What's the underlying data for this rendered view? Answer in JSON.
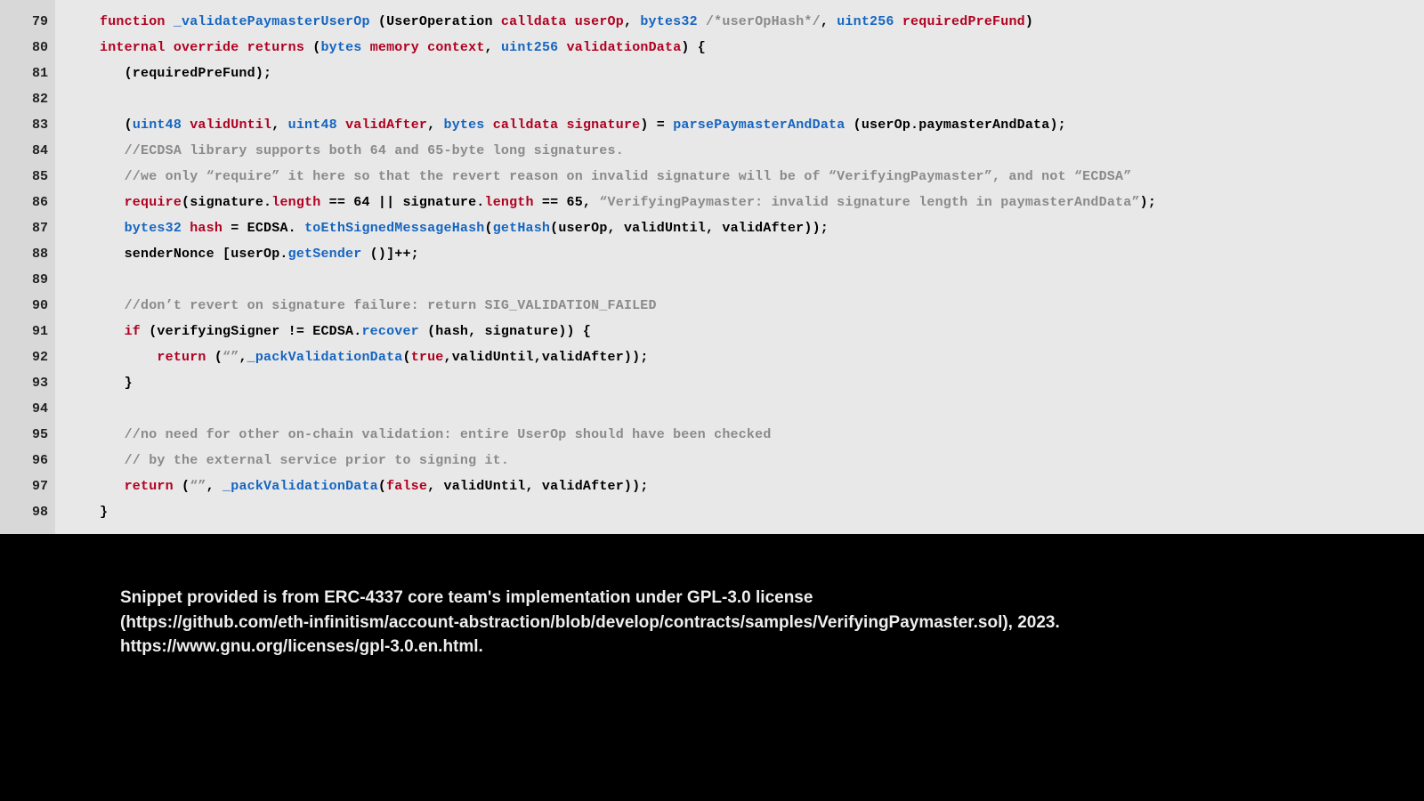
{
  "first_line_no": 79,
  "lines": [
    [
      {
        "cls": "kw",
        "t": "function"
      },
      {
        "t": " "
      },
      {
        "cls": "fn",
        "t": "_validatePaymasterUserOp"
      },
      {
        "t": " ("
      },
      {
        "t": "UserOperation "
      },
      {
        "cls": "kw",
        "t": "calldata"
      },
      {
        "t": " "
      },
      {
        "cls": "kw",
        "t": "userOp"
      },
      {
        "t": ", "
      },
      {
        "cls": "type",
        "t": "bytes32"
      },
      {
        "t": " "
      },
      {
        "cls": "cmt",
        "t": "/*userOpHash*/"
      },
      {
        "t": ", "
      },
      {
        "cls": "type",
        "t": "uint256"
      },
      {
        "t": " "
      },
      {
        "cls": "kw",
        "t": "requiredPreFund"
      },
      {
        "t": ")"
      }
    ],
    [
      {
        "cls": "kw",
        "t": "internal"
      },
      {
        "t": " "
      },
      {
        "cls": "kw",
        "t": "override"
      },
      {
        "t": " "
      },
      {
        "cls": "kw",
        "t": "returns"
      },
      {
        "t": " ("
      },
      {
        "cls": "type",
        "t": "bytes"
      },
      {
        "t": " "
      },
      {
        "cls": "kw",
        "t": "memory"
      },
      {
        "t": " "
      },
      {
        "cls": "kw",
        "t": "context"
      },
      {
        "t": ", "
      },
      {
        "cls": "type",
        "t": "uint256"
      },
      {
        "t": " "
      },
      {
        "cls": "kw",
        "t": "validationData"
      },
      {
        "t": ") {"
      }
    ],
    [
      {
        "t": "   (requiredPreFund);"
      }
    ],
    [
      {
        "t": ""
      }
    ],
    [
      {
        "t": "   ("
      },
      {
        "cls": "type",
        "t": "uint48"
      },
      {
        "t": " "
      },
      {
        "cls": "kw",
        "t": "validUntil"
      },
      {
        "t": ", "
      },
      {
        "cls": "type",
        "t": "uint48"
      },
      {
        "t": " "
      },
      {
        "cls": "kw",
        "t": "validAfter"
      },
      {
        "t": ", "
      },
      {
        "cls": "type",
        "t": "bytes"
      },
      {
        "t": " "
      },
      {
        "cls": "kw",
        "t": "calldata"
      },
      {
        "t": " "
      },
      {
        "cls": "kw",
        "t": "signature"
      },
      {
        "t": ") = "
      },
      {
        "cls": "fn",
        "t": "parsePaymasterAndData"
      },
      {
        "t": " (userOp.paymasterAndData);"
      }
    ],
    [
      {
        "t": "   "
      },
      {
        "cls": "cmt",
        "t": "//ECDSA library supports both 64 and 65-byte long signatures."
      }
    ],
    [
      {
        "t": "   "
      },
      {
        "cls": "cmt",
        "t": "//we only “require” it here so that the revert reason on invalid signature will be of “VerifyingPaymaster”, and not “ECDSA”"
      }
    ],
    [
      {
        "t": "   "
      },
      {
        "cls": "kw",
        "t": "require"
      },
      {
        "t": "(signature."
      },
      {
        "cls": "kw",
        "t": "length"
      },
      {
        "t": " == 64 || signature."
      },
      {
        "cls": "kw",
        "t": "length"
      },
      {
        "t": " == 65, "
      },
      {
        "cls": "str",
        "t": "“VerifyingPaymaster: invalid signature length in paymasterAndData”"
      },
      {
        "t": ");"
      }
    ],
    [
      {
        "t": "   "
      },
      {
        "cls": "type",
        "t": "bytes32"
      },
      {
        "t": " "
      },
      {
        "cls": "kw",
        "t": "hash"
      },
      {
        "t": " = ECDSA."
      },
      {
        "cls": "fn",
        "t": " toEthSignedMessageHash"
      },
      {
        "t": "("
      },
      {
        "cls": "fn",
        "t": "getHash"
      },
      {
        "t": "(userOp, validUntil, validAfter));"
      }
    ],
    [
      {
        "t": "   senderNonce [userOp."
      },
      {
        "cls": "fn",
        "t": "getSender"
      },
      {
        "t": " ()]++;"
      }
    ],
    [
      {
        "t": ""
      }
    ],
    [
      {
        "t": "   "
      },
      {
        "cls": "cmt",
        "t": "//don’t revert on signature failure: return SIG_VALIDATION_FAILED"
      }
    ],
    [
      {
        "t": "   "
      },
      {
        "cls": "kw",
        "t": "if"
      },
      {
        "t": " (verifyingSigner != ECDSA."
      },
      {
        "cls": "fn",
        "t": "recover"
      },
      {
        "t": " (hash, signature)) {"
      }
    ],
    [
      {
        "t": "       "
      },
      {
        "cls": "kw",
        "t": "return"
      },
      {
        "t": " ("
      },
      {
        "cls": "str",
        "t": "“”"
      },
      {
        "t": ","
      },
      {
        "cls": "fn",
        "t": "_packValidationData"
      },
      {
        "t": "("
      },
      {
        "cls": "kw",
        "t": "true"
      },
      {
        "t": ",validUntil,validAfter));"
      }
    ],
    [
      {
        "t": "   }"
      }
    ],
    [
      {
        "t": ""
      }
    ],
    [
      {
        "t": "   "
      },
      {
        "cls": "cmt",
        "t": "//no need for other on-chain validation: entire UserOp should have been checked"
      }
    ],
    [
      {
        "t": "   "
      },
      {
        "cls": "cmt",
        "t": "// by the external service prior to signing it."
      }
    ],
    [
      {
        "t": "   "
      },
      {
        "cls": "kw",
        "t": "return"
      },
      {
        "t": " ("
      },
      {
        "cls": "str",
        "t": "“”"
      },
      {
        "t": ", "
      },
      {
        "cls": "fn",
        "t": "_packValidationData"
      },
      {
        "t": "("
      },
      {
        "cls": "kw",
        "t": "false"
      },
      {
        "t": ", validUntil, validAfter));"
      }
    ],
    [
      {
        "t": "}"
      }
    ]
  ],
  "indent_first_two": 0,
  "attribution": {
    "l1": "Snippet provided is from ERC-4337 core team's implementation under GPL-3.0 license",
    "l2": "(https://github.com/eth-infinitism/account-abstraction/blob/develop/contracts/samples/VerifyingPaymaster.sol), 2023.",
    "l3": "https://www.gnu.org/licenses/gpl-3.0.en.html."
  }
}
